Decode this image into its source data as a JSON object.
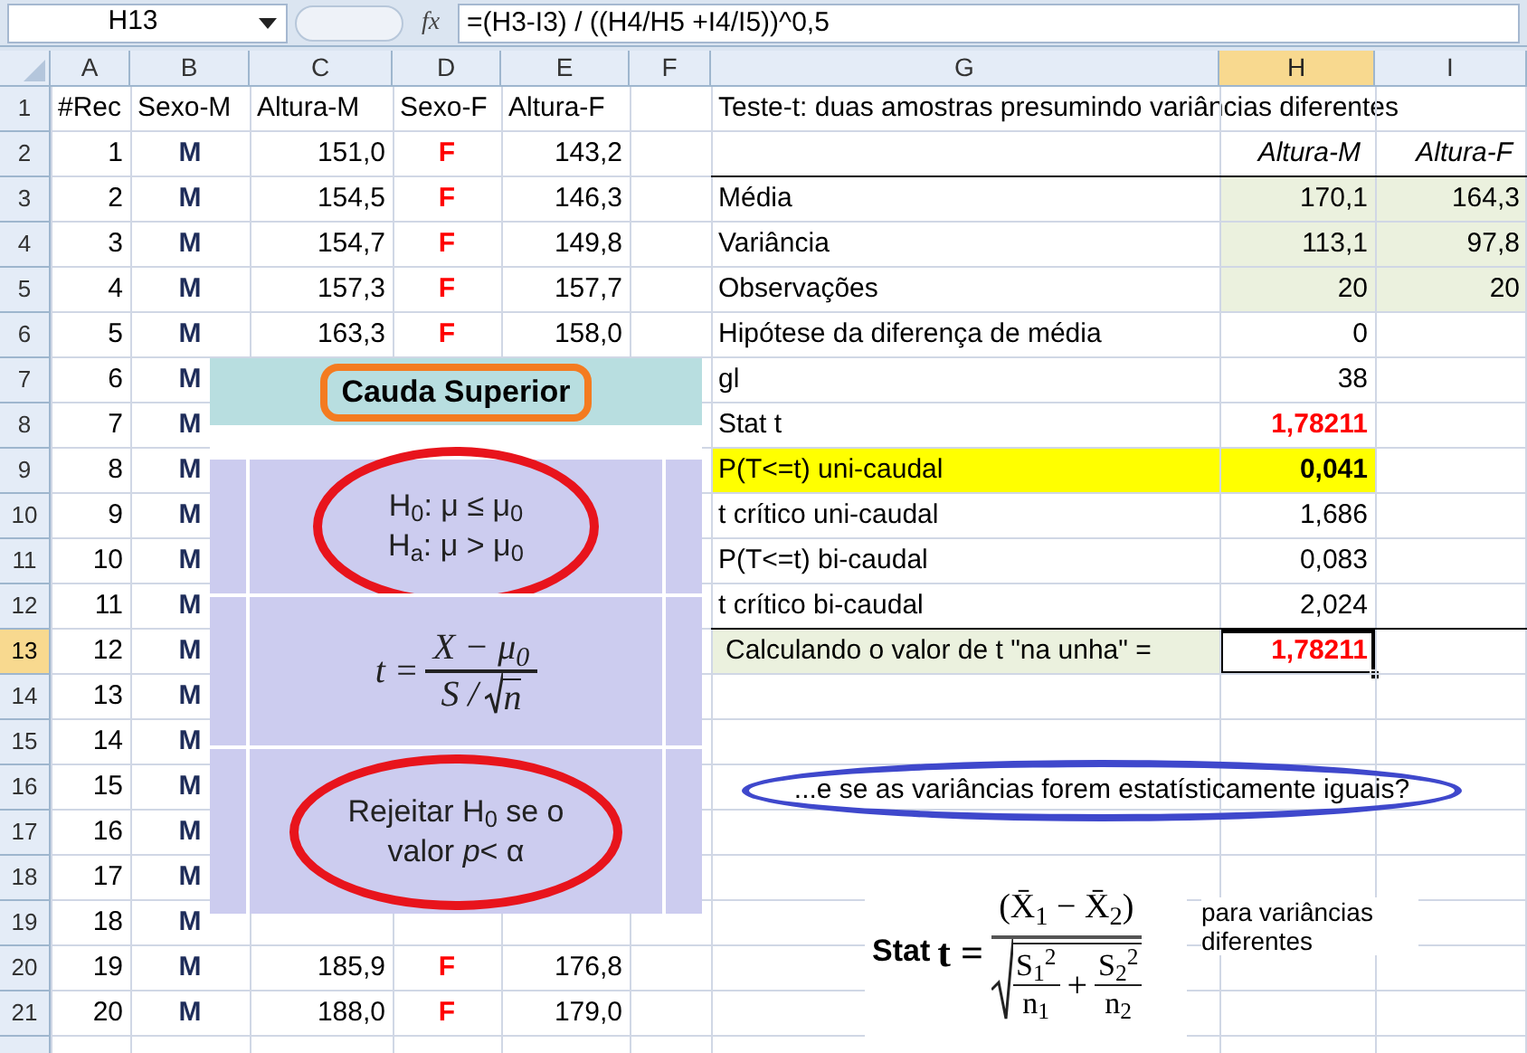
{
  "name_box": "H13",
  "function_label": "fx",
  "formula": "=(H3-I3) / ((H4/H5 +I4/I5))^0,5",
  "columns": [
    {
      "label": "A",
      "selected": false
    },
    {
      "label": "B",
      "selected": false
    },
    {
      "label": "C",
      "selected": false
    },
    {
      "label": "D",
      "selected": false
    },
    {
      "label": "E",
      "selected": false
    },
    {
      "label": "F",
      "selected": false
    },
    {
      "label": "G",
      "selected": false
    },
    {
      "label": "H",
      "selected": true
    },
    {
      "label": "I",
      "selected": false
    }
  ],
  "rows": [
    {
      "label": "1",
      "selected": false,
      "rule_below": false,
      "cells": [
        {
          "kind": "text",
          "text": "#Rec"
        },
        {
          "kind": "text",
          "text": "Sexo-M"
        },
        {
          "kind": "text",
          "text": "Altura-M"
        },
        {
          "kind": "text",
          "text": "Sexo-F"
        },
        {
          "kind": "text",
          "text": "Altura-F"
        },
        null,
        {
          "kind": "title",
          "text": "Teste-t: duas amostras presumindo variâncias diferentes"
        },
        null,
        null
      ]
    },
    {
      "label": "2",
      "selected": false,
      "rule_below": true,
      "cells": [
        {
          "kind": "number",
          "text": "1"
        },
        {
          "kind": "male",
          "text": "M"
        },
        {
          "kind": "number",
          "text": "151,0"
        },
        {
          "kind": "female",
          "text": "F"
        },
        {
          "kind": "number",
          "text": "143,2"
        },
        null,
        null,
        {
          "kind": "italic_head",
          "text": "Altura-M"
        },
        {
          "kind": "italic_head",
          "text": "Altura-F"
        }
      ]
    },
    {
      "label": "3",
      "selected": false,
      "rule_below": false,
      "cells": [
        {
          "kind": "number",
          "text": "2"
        },
        {
          "kind": "male",
          "text": "M"
        },
        {
          "kind": "number",
          "text": "154,5"
        },
        {
          "kind": "female",
          "text": "F"
        },
        {
          "kind": "number",
          "text": "146,3"
        },
        null,
        {
          "kind": "label",
          "text": "Média"
        },
        {
          "kind": "value_green",
          "text": "170,1"
        },
        {
          "kind": "value_green",
          "text": "164,3"
        }
      ]
    },
    {
      "label": "4",
      "selected": false,
      "rule_below": false,
      "cells": [
        {
          "kind": "number",
          "text": "3"
        },
        {
          "kind": "male",
          "text": "M"
        },
        {
          "kind": "number",
          "text": "154,7"
        },
        {
          "kind": "female",
          "text": "F"
        },
        {
          "kind": "number",
          "text": "149,8"
        },
        null,
        {
          "kind": "label",
          "text": "Variância"
        },
        {
          "kind": "value_green",
          "text": "113,1"
        },
        {
          "kind": "value_green",
          "text": "97,8"
        }
      ]
    },
    {
      "label": "5",
      "selected": false,
      "rule_below": false,
      "cells": [
        {
          "kind": "number",
          "text": "4"
        },
        {
          "kind": "male",
          "text": "M"
        },
        {
          "kind": "number",
          "text": "157,3"
        },
        {
          "kind": "female",
          "text": "F"
        },
        {
          "kind": "number",
          "text": "157,7"
        },
        null,
        {
          "kind": "label",
          "text": "Observações"
        },
        {
          "kind": "value_green",
          "text": "20"
        },
        {
          "kind": "value_green",
          "text": "20"
        }
      ]
    },
    {
      "label": "6",
      "selected": false,
      "rule_below": false,
      "cells": [
        {
          "kind": "number",
          "text": "5"
        },
        {
          "kind": "male",
          "text": "M"
        },
        {
          "kind": "number",
          "text": "163,3"
        },
        {
          "kind": "female",
          "text": "F"
        },
        {
          "kind": "number",
          "text": "158,0"
        },
        null,
        {
          "kind": "label",
          "text": "Hipótese da diferença de média"
        },
        {
          "kind": "number",
          "text": "0"
        },
        null
      ]
    },
    {
      "label": "7",
      "selected": false,
      "rule_below": false,
      "cells": [
        {
          "kind": "number",
          "text": "6"
        },
        {
          "kind": "male",
          "text": "M"
        },
        null,
        null,
        null,
        null,
        {
          "kind": "label",
          "text": "gl"
        },
        {
          "kind": "number",
          "text": "38"
        },
        null
      ]
    },
    {
      "label": "8",
      "selected": false,
      "rule_below": false,
      "cells": [
        {
          "kind": "number",
          "text": "7"
        },
        {
          "kind": "male",
          "text": "M"
        },
        null,
        null,
        null,
        null,
        {
          "kind": "label",
          "text": "Stat t"
        },
        {
          "kind": "value_red_bold",
          "text": "1,78211"
        },
        null
      ]
    },
    {
      "label": "9",
      "selected": false,
      "rule_below": false,
      "cells": [
        {
          "kind": "number",
          "text": "8"
        },
        {
          "kind": "male",
          "text": "M"
        },
        null,
        null,
        null,
        null,
        {
          "kind": "label_yellow",
          "text": "P(T<=t) uni-caudal"
        },
        {
          "kind": "value_yellow_bold",
          "text": "0,041"
        },
        null
      ]
    },
    {
      "label": "10",
      "selected": false,
      "rule_below": false,
      "cells": [
        {
          "kind": "number",
          "text": "9"
        },
        {
          "kind": "male",
          "text": "M"
        },
        null,
        null,
        null,
        null,
        {
          "kind": "label",
          "text": "t crítico uni-caudal"
        },
        {
          "kind": "number",
          "text": "1,686"
        },
        null
      ]
    },
    {
      "label": "11",
      "selected": false,
      "rule_below": false,
      "cells": [
        {
          "kind": "number",
          "text": "10"
        },
        {
          "kind": "male",
          "text": "M"
        },
        null,
        null,
        null,
        null,
        {
          "kind": "label",
          "text": "P(T<=t) bi-caudal"
        },
        {
          "kind": "number",
          "text": "0,083"
        },
        null
      ]
    },
    {
      "label": "12",
      "selected": false,
      "rule_below": true,
      "cells": [
        {
          "kind": "number",
          "text": "11"
        },
        {
          "kind": "male",
          "text": "M"
        },
        null,
        null,
        null,
        null,
        {
          "kind": "label",
          "text": "t crítico bi-caudal"
        },
        {
          "kind": "number",
          "text": "2,024"
        },
        null
      ]
    },
    {
      "label": "13",
      "selected": true,
      "rule_below": false,
      "cells": [
        {
          "kind": "number",
          "text": "12"
        },
        {
          "kind": "male",
          "text": "M"
        },
        null,
        null,
        null,
        null,
        {
          "kind": "label_green",
          "text": "Calculando o valor de t \"na unha\" ="
        },
        {
          "kind": "result",
          "text": "1,78211"
        },
        null
      ]
    },
    {
      "label": "14",
      "selected": false,
      "rule_below": false,
      "cells": [
        {
          "kind": "number",
          "text": "13"
        },
        {
          "kind": "male",
          "text": "M"
        },
        null,
        null,
        null,
        null,
        null,
        null,
        null
      ]
    },
    {
      "label": "15",
      "selected": false,
      "rule_below": false,
      "cells": [
        {
          "kind": "number",
          "text": "14"
        },
        {
          "kind": "male",
          "text": "M"
        },
        null,
        null,
        null,
        null,
        null,
        null,
        null
      ]
    },
    {
      "label": "16",
      "selected": false,
      "rule_below": false,
      "cells": [
        {
          "kind": "number",
          "text": "15"
        },
        {
          "kind": "male",
          "text": "M"
        },
        null,
        null,
        null,
        null,
        null,
        null,
        null
      ]
    },
    {
      "label": "17",
      "selected": false,
      "rule_below": false,
      "cells": [
        {
          "kind": "number",
          "text": "16"
        },
        {
          "kind": "male",
          "text": "M"
        },
        null,
        null,
        null,
        null,
        null,
        null,
        null
      ]
    },
    {
      "label": "18",
      "selected": false,
      "rule_below": false,
      "cells": [
        {
          "kind": "number",
          "text": "17"
        },
        {
          "kind": "male",
          "text": "M"
        },
        null,
        null,
        null,
        null,
        null,
        null,
        null
      ]
    },
    {
      "label": "19",
      "selected": false,
      "rule_below": false,
      "cells": [
        {
          "kind": "number",
          "text": "18"
        },
        {
          "kind": "male",
          "text": "M"
        },
        null,
        null,
        null,
        null,
        null,
        null,
        null
      ]
    },
    {
      "label": "20",
      "selected": false,
      "rule_below": false,
      "cells": [
        {
          "kind": "number",
          "text": "19"
        },
        {
          "kind": "male",
          "text": "M"
        },
        {
          "kind": "number",
          "text": "185,9"
        },
        {
          "kind": "female",
          "text": "F"
        },
        {
          "kind": "number",
          "text": "176,8"
        },
        null,
        null,
        null,
        null
      ]
    },
    {
      "label": "21",
      "selected": false,
      "rule_below": false,
      "cells": [
        {
          "kind": "number",
          "text": "20"
        },
        {
          "kind": "male",
          "text": "M"
        },
        {
          "kind": "number",
          "text": "188,0"
        },
        {
          "kind": "female",
          "text": "F"
        },
        {
          "kind": "number",
          "text": "179,0"
        },
        null,
        null,
        null,
        null
      ]
    }
  ],
  "slide": {
    "heading": "Cauda Superior",
    "hypotheses": [
      "H$_{0}$: μ ≤ μ$_{0}$",
      "H$_{a}$: μ > μ$_{0}$"
    ],
    "statistic": {
      "lhs": "t =",
      "numerator": "X − μ$_{0}$",
      "denominator_left": "S /",
      "denominator_root": "n"
    },
    "rule": "Rejeitar H$_{0}$ se o valor *p*< α"
  },
  "callout": "...e se as variâncias forem estatísticamente iguais?",
  "formula_image": {
    "label": "Stat",
    "lhs": "t =",
    "numerator": "(X̄$_{1}$ − X̄$_{2}$)",
    "terms": [
      {
        "top": "S$_{1}$$^{2}$",
        "bottom": "n$_{1}$"
      },
      {
        "top": "S$_{2}$$^{2}$",
        "bottom": "n$_{2}$"
      }
    ],
    "operator": "+",
    "caption": "para variâncias diferentes"
  }
}
